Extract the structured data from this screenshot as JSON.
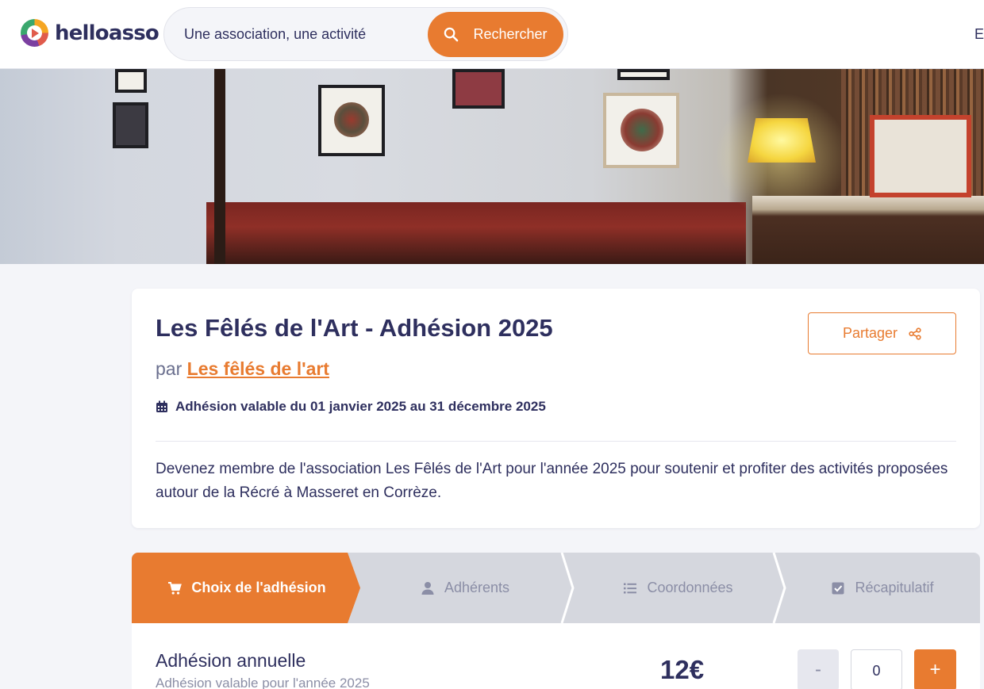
{
  "brand": {
    "name": "helloasso",
    "accent": "#e87b30",
    "ink": "#2e2f5e"
  },
  "header": {
    "search_placeholder": "Une association, une activité",
    "search_button": "Rechercher",
    "cut_text": "E"
  },
  "campaign": {
    "title": "Les Fêlés de l'Art - Adhésion 2025",
    "by_prefix": "par",
    "organization": "Les fêlés de l'art",
    "validity": "Adhésion valable du 01 janvier 2025 au 31 décembre 2025",
    "share_label": "Partager",
    "description": "Devenez membre de l'association Les Fêlés de l'Art pour l'année 2025 pour soutenir et profiter des activités proposées autour de la Récré à Masseret en Corrèze."
  },
  "steps": [
    {
      "label": "Choix de l'adhésion",
      "icon": "cart-icon",
      "active": true
    },
    {
      "label": "Adhérents",
      "icon": "user-icon",
      "active": false
    },
    {
      "label": "Coordonnées",
      "icon": "list-icon",
      "active": false
    },
    {
      "label": "Récapitulatif",
      "icon": "check-square-icon",
      "active": false
    }
  ],
  "product": {
    "name": "Adhésion annuelle",
    "subtitle": "Adhésion valable pour l'année 2025",
    "price": "12€",
    "quantity": "0",
    "minus_label": "-",
    "plus_label": "+"
  }
}
